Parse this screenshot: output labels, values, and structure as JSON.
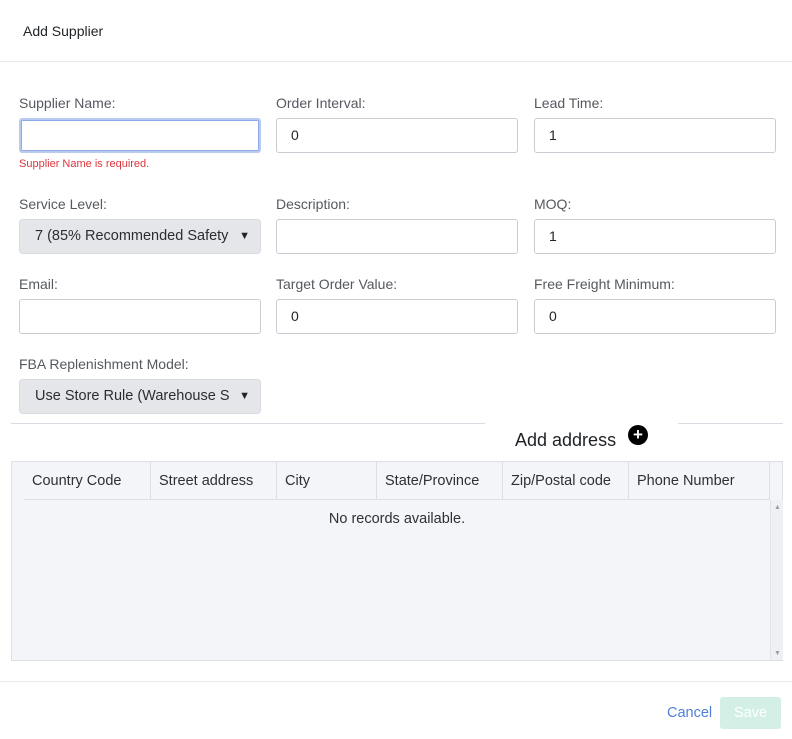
{
  "dialog": {
    "title": "Add Supplier"
  },
  "form": {
    "supplier_name": {
      "label": "Supplier Name:",
      "value": "",
      "error": "Supplier Name is required."
    },
    "order_interval": {
      "label": "Order Interval:",
      "value": "0"
    },
    "lead_time": {
      "label": "Lead Time:",
      "value": "1"
    },
    "service_level": {
      "label": "Service Level:",
      "value": "7 (85% Recommended Safety"
    },
    "description": {
      "label": "Description:",
      "value": ""
    },
    "moq": {
      "label": "MOQ:",
      "value": "1"
    },
    "email": {
      "label": "Email:",
      "value": ""
    },
    "target_order_value": {
      "label": "Target Order Value:",
      "value": "0"
    },
    "free_freight_minimum": {
      "label": "Free Freight Minimum:",
      "value": "0"
    },
    "fba_model": {
      "label": "FBA Replenishment Model:",
      "value": "Use Store Rule (Warehouse S"
    }
  },
  "address": {
    "title": "Add address",
    "plus_icon": "plus-circle-icon",
    "columns": [
      "Country Code",
      "Street address",
      "City",
      "State/Province",
      "Zip/Postal code",
      "Phone Number"
    ],
    "empty_text": "No records available."
  },
  "footer": {
    "cancel_label": "Cancel",
    "save_label": "Save"
  },
  "colors": {
    "error": "#d9363e",
    "link": "#4f7fd8",
    "save_disabled": "#d3efe6"
  }
}
